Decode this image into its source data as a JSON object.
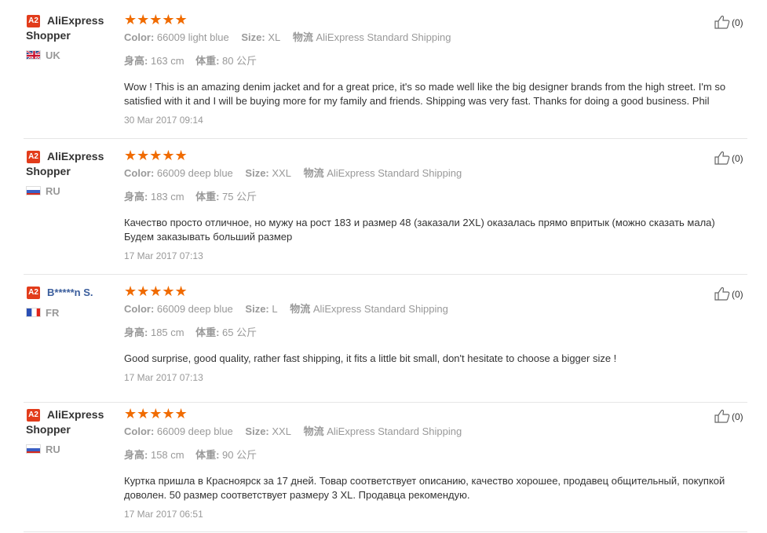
{
  "reviews": [
    {
      "badge": "A2",
      "user": "AliExpress Shopper",
      "country_code": "UK",
      "flag": "uk",
      "stars": "★★★★★",
      "color_label": "Color:",
      "color_value": "66009 light blue",
      "size_label": "Size:",
      "size_value": "XL",
      "ship_label": "物流",
      "ship_value": "AliExpress Standard Shipping",
      "height_label": "身高:",
      "height_value": "163 cm",
      "weight_label": "体重:",
      "weight_value": "80 公斤",
      "text": "Wow ! This is an amazing denim jacket and for a great price, it's so made well like the big designer brands from the high street. I'm so satisfied with it and I will be buying more for my family and friends. Shipping was very fast. Thanks for doing a good business. Phil",
      "date": "30 Mar 2017 09:14",
      "helpful": "(0)"
    },
    {
      "badge": "A2",
      "user": "AliExpress Shopper",
      "country_code": "RU",
      "flag": "ru",
      "stars": "★★★★★",
      "color_label": "Color:",
      "color_value": "66009 deep blue",
      "size_label": "Size:",
      "size_value": "XXL",
      "ship_label": "物流",
      "ship_value": "AliExpress Standard Shipping",
      "height_label": "身高:",
      "height_value": "183 cm",
      "weight_label": "体重:",
      "weight_value": "75 公斤",
      "text": "Качество просто отличное, но мужу на рост 183 и размер 48 (заказали 2XL) оказалась прямо впритык (можно сказать мала) Будем заказывать больший размер",
      "date": "17 Mar 2017 07:13",
      "helpful": "(0)"
    },
    {
      "badge": "A2",
      "user": "B*****n S.",
      "country_code": "FR",
      "flag": "fr",
      "stars": "★★★★★",
      "color_label": "Color:",
      "color_value": "66009 deep blue",
      "size_label": "Size:",
      "size_value": "L",
      "ship_label": "物流",
      "ship_value": "AliExpress Standard Shipping",
      "height_label": "身高:",
      "height_value": "185 cm",
      "weight_label": "体重:",
      "weight_value": "65 公斤",
      "text": "Good surprise, good quality, rather fast shipping, it fits a little bit small, don't hesitate to choose a bigger size !",
      "date": "17 Mar 2017 07:13",
      "helpful": "(0)"
    },
    {
      "badge": "A2",
      "user": "AliExpress Shopper",
      "country_code": "RU",
      "flag": "ru",
      "stars": "★★★★★",
      "color_label": "Color:",
      "color_value": "66009 deep blue",
      "size_label": "Size:",
      "size_value": "XXL",
      "ship_label": "物流",
      "ship_value": "AliExpress Standard Shipping",
      "height_label": "身高:",
      "height_value": "158 cm",
      "weight_label": "体重:",
      "weight_value": "90 公斤",
      "text": "Куртка пришла в Красноярск за 17 дней. Товар соответствует описанию, качество хорошее, продавец общительный, покупкой доволен. 50 размер соответствует размеру 3 XL. Продавца рекомендую.",
      "date": "17 Mar 2017 06:51",
      "helpful": "(0)"
    }
  ],
  "colors": {
    "star": "#f06b00",
    "badge": "#e23c1b",
    "name_link": "#3a5d9c"
  }
}
